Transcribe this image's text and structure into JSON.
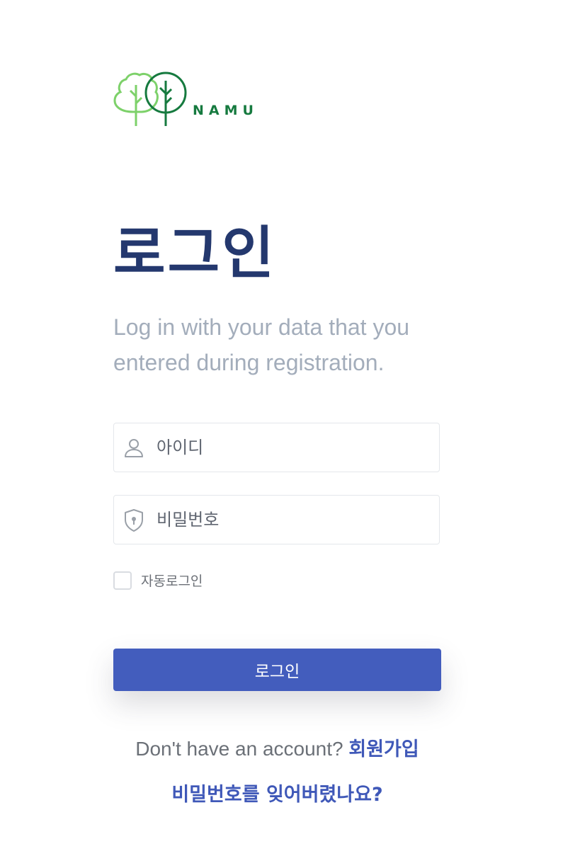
{
  "brand": {
    "name": "NAMU",
    "logo_icon": "two-trees-icon",
    "colors": {
      "light_green": "#7dd16a",
      "dark_green": "#167a3f"
    }
  },
  "page": {
    "title": "로그인",
    "subtitle": "Log in with your data that you entered during registration."
  },
  "form": {
    "id_field": {
      "placeholder": "아이디",
      "value": "",
      "icon": "user-icon"
    },
    "password_field": {
      "placeholder": "비밀번호",
      "value": "",
      "icon": "shield-lock-icon"
    },
    "remember": {
      "label": "자동로그인",
      "checked": false
    },
    "submit_label": "로그인"
  },
  "footer": {
    "no_account_text": "Don't have an account?",
    "signup_label": "회원가입",
    "forgot_label": "비밀번호를 잊어버렸나요?"
  },
  "colors": {
    "title": "#24386e",
    "accent": "#435dbd",
    "muted_text": "#a3adbb"
  }
}
